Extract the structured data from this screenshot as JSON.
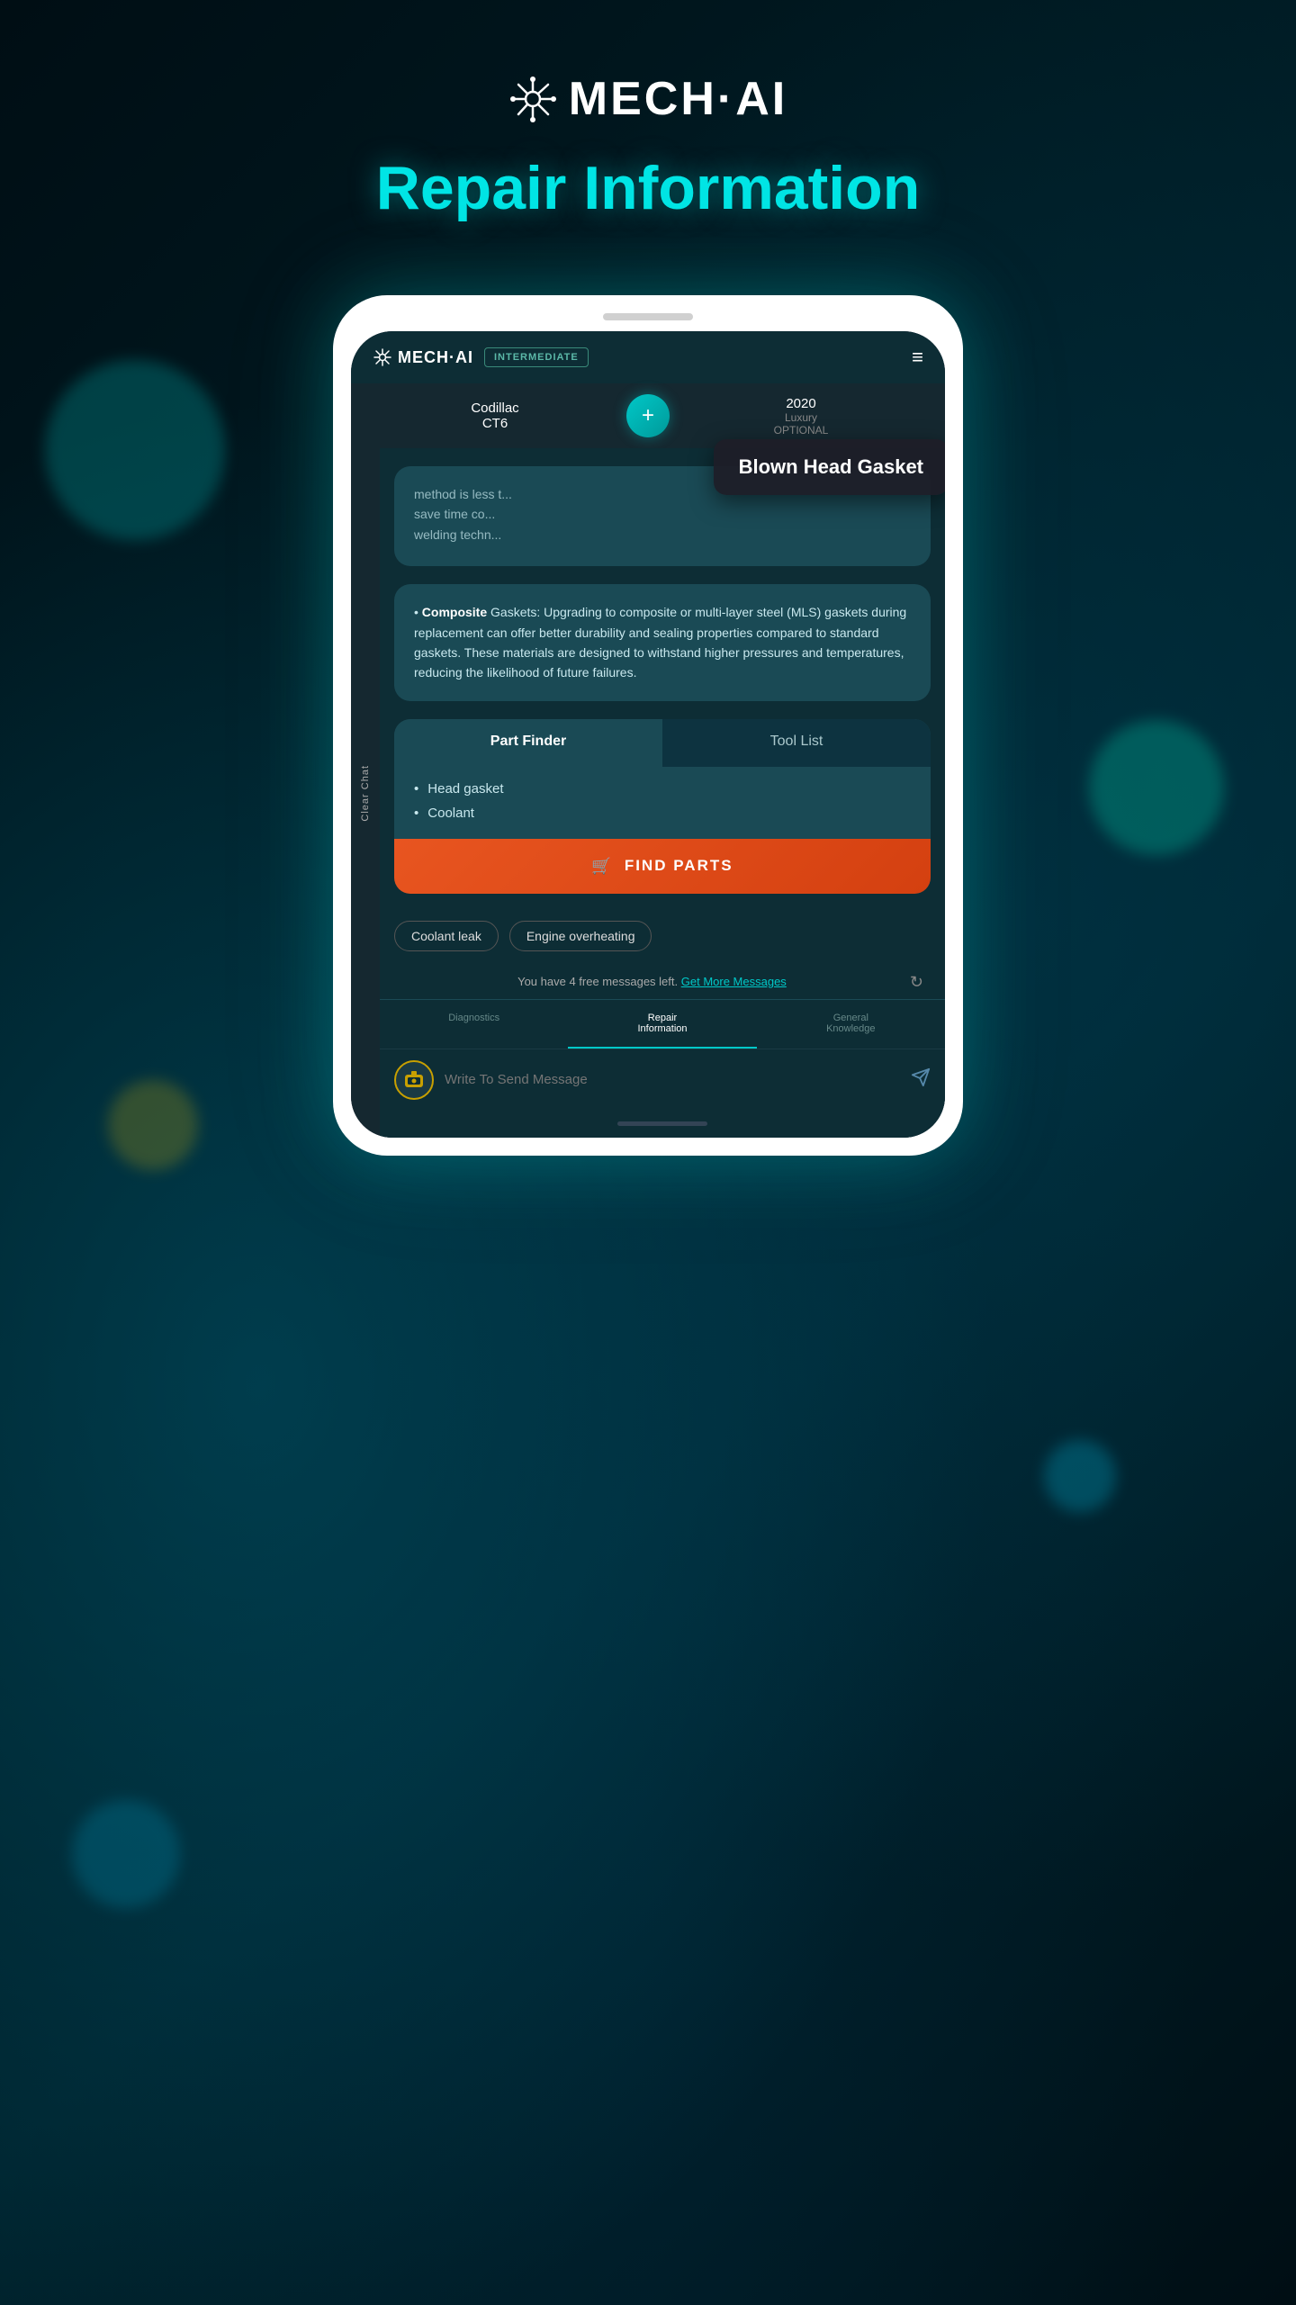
{
  "app": {
    "name": "MECH·AI",
    "dot": "·",
    "title": "Repair Information"
  },
  "header": {
    "logo": "MECH·AI",
    "badge": "INTERMEDIATE",
    "menu_icon": "≡"
  },
  "vehicle": {
    "make": "Codillac",
    "model": "CT6",
    "year": "2020",
    "tier": "Luxury",
    "optional_text": "OPTIONAL"
  },
  "chat": {
    "sidebar_label": "Clear Chat",
    "message_partial": "method is less t... save time co... welding techn...",
    "tooltip_text": "Blown Head Gasket",
    "bullet_1_bold": "Composite",
    "bullet_1_rest": " Gaskets: Upgrading to composite or multi-layer steel (MLS) gaskets during replacement can offer better durability and sealing properties compared to standard gaskets. These materials are designed to withstand higher pressures and temperatures, reducing the likelihood of future failures."
  },
  "part_finder": {
    "tab1_label": "Part Finder",
    "tab2_label": "Tool List",
    "parts": [
      "Head gasket",
      "Coolant"
    ],
    "find_parts_label": "FIND PARTS",
    "cart_icon": "🛒"
  },
  "suggestions": {
    "chip1": "Coolant leak",
    "chip2": "Engine overheating"
  },
  "free_messages": {
    "text": "You have 4 free messages left.",
    "link_text": "Get More Messages"
  },
  "bottom_nav": {
    "item1": "Diagnostics",
    "item2": "Repair\nInformation",
    "item3": "General\nKnowledge"
  },
  "input": {
    "placeholder": "Write To Send Message"
  },
  "colors": {
    "accent": "#00e5e5",
    "orange": "#e85520",
    "teal_dark": "#0d2d35",
    "teal_mid": "#1a4a55"
  }
}
